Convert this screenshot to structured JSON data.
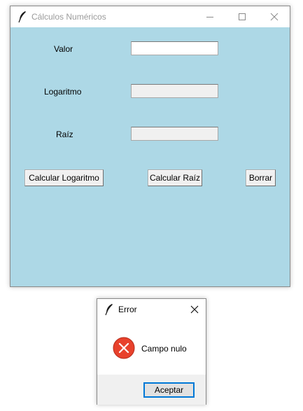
{
  "main_window": {
    "title": "Cálculos Numéricos",
    "background_color": "#add8e6",
    "title_icon": "feather-icon",
    "controls": [
      "minimize-icon",
      "maximize-icon",
      "close-icon"
    ],
    "fields": {
      "valor": {
        "label": "Valor",
        "value": ""
      },
      "logaritmo": {
        "label": "Logaritmo",
        "value": ""
      },
      "raiz": {
        "label": "Raíz",
        "value": ""
      }
    },
    "buttons": {
      "calcular_logaritmo": "Calcular Logaritmo",
      "calcular_raiz": "Calcular Raíz",
      "borrar": "Borrar"
    }
  },
  "error_dialog": {
    "title": "Error",
    "title_icon": "feather-icon",
    "icon": "error-icon",
    "icon_color": "#e8412c",
    "message": "Campo nulo",
    "ok_button": "Aceptar",
    "focus_color": "#0078d7"
  }
}
